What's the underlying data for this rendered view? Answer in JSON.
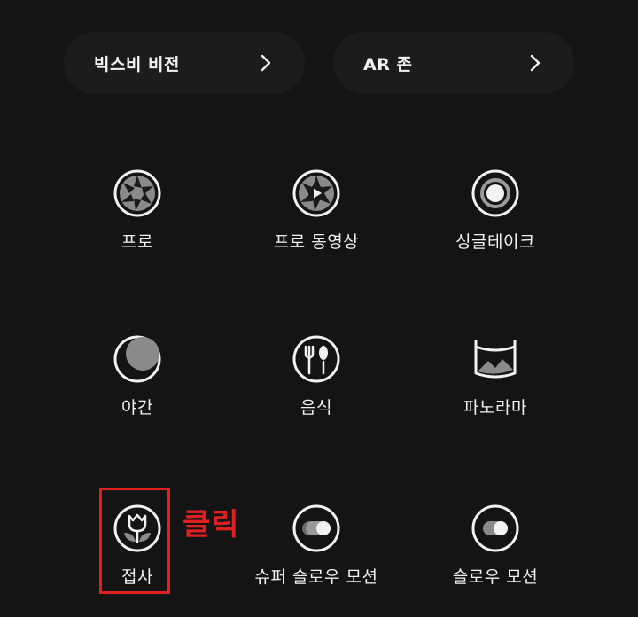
{
  "top_buttons": {
    "bixby": "빅스비 비전",
    "ar": "AR 존"
  },
  "modes": {
    "pro": "프로",
    "pro_video": "프로 동영상",
    "single_take": "싱글테이크",
    "night": "야간",
    "food": "음식",
    "panorama": "파노라마",
    "macro": "접사",
    "super_slow": "슈퍼 슬로우 모션",
    "slow": "슬로우 모션"
  },
  "annotation": {
    "text": "클릭",
    "color": "#e02020"
  },
  "icons": [
    "chevron-right-icon",
    "aperture-icon",
    "video-aperture-icon",
    "single-take-icon",
    "moon-icon",
    "fork-spoon-icon",
    "panorama-icon",
    "flower-icon",
    "super-slow-icon",
    "slow-icon"
  ]
}
